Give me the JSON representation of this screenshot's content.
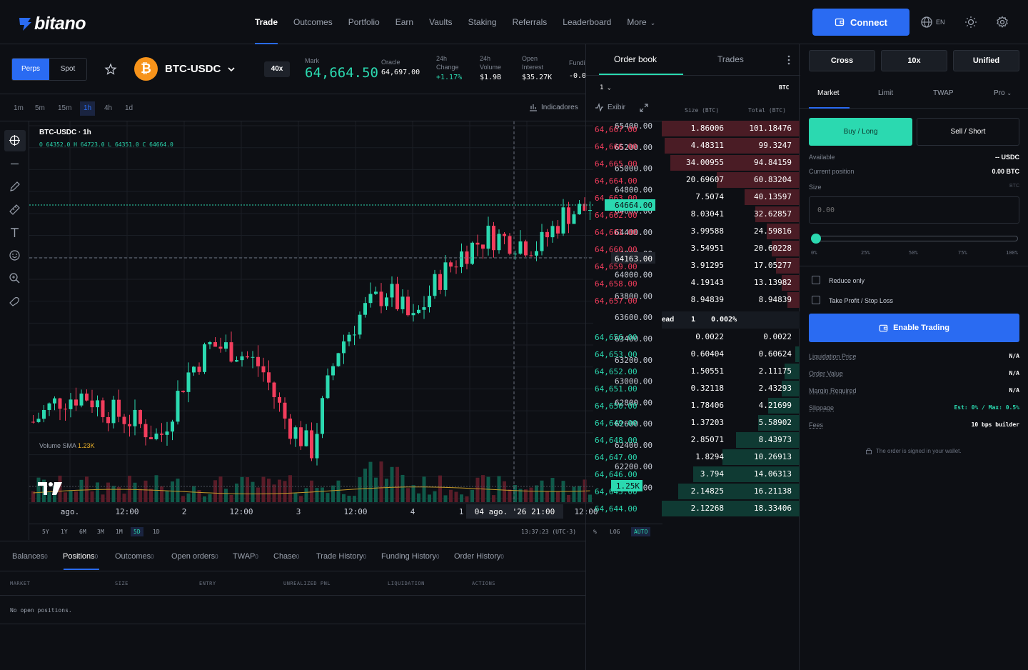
{
  "brand": {
    "name": "bitano"
  },
  "nav": {
    "links": [
      "Trade",
      "Outcomes",
      "Portfolio",
      "Earn",
      "Vaults",
      "Staking",
      "Referrals",
      "Leaderboard",
      "More"
    ],
    "active": "Trade",
    "connect_label": "Connect",
    "lang": "EN"
  },
  "market": {
    "toggle": [
      "Perps",
      "Spot"
    ],
    "pair": "BTC-USDC",
    "leverage_badge": "40x",
    "mark_label": "Mark",
    "mark_value": "64,664.50",
    "oracle_label": "Oracle",
    "oracle_value": "64,697.00",
    "change_label_1": "24h",
    "change_label_2": "Change",
    "change_value": "+1.17%",
    "volume_label_1": "24h",
    "volume_label_2": "Volume",
    "volume_value": "$1.9B",
    "oi_label_1": "Open",
    "oi_label_2": "Interest",
    "oi_value": "$35.27K",
    "funding_label": "Fundi",
    "funding_value": "-0.0"
  },
  "timeframes": [
    "1m",
    "5m",
    "15m",
    "1h",
    "4h",
    "1d"
  ],
  "active_timeframe": "1h",
  "chart_toolbar": {
    "indicators": "Indicadores",
    "view": "Exibir"
  },
  "chart_legend": {
    "title": "BTC-USDC · 1h",
    "ohlc": "O 64352.0 H 64723.0 L 64351.0 C 64664.0",
    "volume_sma_label": "Volume SMA",
    "volume_sma_value": "1.23K"
  },
  "chart_data": {
    "type": "candlestick",
    "price_axis_ticks": [
      "65400.00",
      "65200.00",
      "65000.00",
      "64800.00",
      "64600.00",
      "64400.00",
      "64200.00",
      "64000.00",
      "63800.00",
      "63600.00",
      "63400.00",
      "63200.00",
      "63000.00",
      "62800.00",
      "62600.00",
      "62400.00",
      "62200.00",
      "62000.00"
    ],
    "price_ylim": [
      62000,
      65400
    ],
    "last_price_label": "64664.00",
    "crosshair_price_label": "64163.00",
    "volume_label": "1.25K",
    "time_axis_labels": [
      "ago.",
      "12:00",
      "2",
      "12:00",
      "3",
      "12:00",
      "4",
      "1",
      "12:00"
    ],
    "crosshair_time_label": "04 ago. '26   21:00"
  },
  "range_bar": {
    "ranges": [
      "5Y",
      "1Y",
      "6M",
      "3M",
      "1M",
      "5D",
      "1D"
    ],
    "active": "5D",
    "clock": "13:37:23 (UTC-3)",
    "percent": "%",
    "log": "LOG",
    "auto": "AUTO"
  },
  "bottom": {
    "tabs": [
      {
        "label": "Balances",
        "count": "0"
      },
      {
        "label": "Positions",
        "count": "0"
      },
      {
        "label": "Outcomes",
        "count": "0"
      },
      {
        "label": "Open orders",
        "count": "0"
      },
      {
        "label": "TWAP",
        "count": "0"
      },
      {
        "label": "Chase",
        "count": "0"
      },
      {
        "label": "Trade History",
        "count": "0"
      },
      {
        "label": "Funding History",
        "count": "0"
      },
      {
        "label": "Order History",
        "count": "0"
      }
    ],
    "active_tab": "Positions",
    "columns": [
      "MARKET",
      "SIZE",
      "ENTRY",
      "UNREALIZED PNL",
      "LIQUIDATION",
      "ACTIONS"
    ],
    "empty_text": "No open positions."
  },
  "orderbook": {
    "tabs": [
      "Order book",
      "Trades"
    ],
    "grouping": "1",
    "unit": "BTC",
    "size_header": "Size (BTC)",
    "total_header": "Total (BTC)",
    "asks": [
      {
        "price": "64,667.00",
        "size": "1.86006",
        "total": "101.18476",
        "depth": 1.0
      },
      {
        "price": "64,666.00",
        "size": "4.48311",
        "total": "99.3247",
        "depth": 0.98
      },
      {
        "price": "64,665.00",
        "size": "34.00955",
        "total": "94.84159",
        "depth": 0.94
      },
      {
        "price": "64,664.00",
        "size": "20.69607",
        "total": "60.83204",
        "depth": 0.6
      },
      {
        "price": "64,663.00",
        "size": "7.5074",
        "total": "40.13597",
        "depth": 0.4
      },
      {
        "price": "64,662.00",
        "size": "8.03041",
        "total": "32.62857",
        "depth": 0.32
      },
      {
        "price": "64,661.00",
        "size": "3.99588",
        "total": "24.59816",
        "depth": 0.24
      },
      {
        "price": "64,660.00",
        "size": "3.54951",
        "total": "20.60228",
        "depth": 0.2
      },
      {
        "price": "64,659.00",
        "size": "3.91295",
        "total": "17.05277",
        "depth": 0.17
      },
      {
        "price": "64,658.00",
        "size": "4.19143",
        "total": "13.13982",
        "depth": 0.13
      },
      {
        "price": "64,657.00",
        "size": "8.94839",
        "total": "8.94839",
        "depth": 0.09
      }
    ],
    "spread_label": "ead",
    "spread_value": "1",
    "spread_pct": "0.002%",
    "bids": [
      {
        "price": "64,656.00",
        "size": "0.0022",
        "total": "0.0022",
        "depth": 0.0
      },
      {
        "price": "64,653.00",
        "size": "0.60404",
        "total": "0.60624",
        "depth": 0.03
      },
      {
        "price": "64,652.00",
        "size": "1.50551",
        "total": "2.11175",
        "depth": 0.11
      },
      {
        "price": "64,651.00",
        "size": "0.32118",
        "total": "2.43293",
        "depth": 0.13
      },
      {
        "price": "64,650.00",
        "size": "1.78406",
        "total": "4.21699",
        "depth": 0.23
      },
      {
        "price": "64,649.00",
        "size": "1.37203",
        "total": "5.58902",
        "depth": 0.3
      },
      {
        "price": "64,648.00",
        "size": "2.85071",
        "total": "8.43973",
        "depth": 0.46
      },
      {
        "price": "64,647.00",
        "size": "1.8294",
        "total": "10.26913",
        "depth": 0.56
      },
      {
        "price": "64,646.00",
        "size": "3.794",
        "total": "14.06313",
        "depth": 0.77
      },
      {
        "price": "64,645.00",
        "size": "2.14825",
        "total": "16.21138",
        "depth": 0.88
      },
      {
        "price": "64,644.00",
        "size": "2.12268",
        "total": "18.33406",
        "depth": 1.0
      }
    ]
  },
  "trade": {
    "margin_modes": [
      "Cross",
      "10x",
      "Unified"
    ],
    "order_tabs": [
      "Market",
      "Limit",
      "TWAP",
      "Pro"
    ],
    "active_order_tab": "Market",
    "buy_label": "Buy / Long",
    "sell_label": "Sell / Short",
    "available_label": "Available",
    "available_value": "-- USDC",
    "position_label": "Current position",
    "position_value": "0.00 BTC",
    "size_label": "Size",
    "size_unit": "BTC",
    "size_placeholder": "0.00",
    "size_percent": 0,
    "slider_ticks": [
      "0%",
      "25%",
      "50%",
      "75%",
      "100%"
    ],
    "reduce_only": "Reduce only",
    "tpsl": "Take Profit / Stop Loss",
    "enable_label": "Enable Trading",
    "info": [
      {
        "label": "Liquidation Price",
        "value": "N/A",
        "color": "#ffffff"
      },
      {
        "label": "Order Value",
        "value": "N/A",
        "color": "#ffffff"
      },
      {
        "label": "Margin Required",
        "value": "N/A",
        "color": "#ffffff"
      },
      {
        "label": "Slippage",
        "value": "Est: 0% / Max: 0.5%",
        "color": "#2bd9b0"
      },
      {
        "label": "Fees",
        "value": "10 bps builder",
        "color": "#ffffff"
      }
    ],
    "signed_note": "The order is signed in your wallet."
  },
  "colors": {
    "accent": "#2a6bf2",
    "up": "#2bd9b0",
    "down": "#f23d5c",
    "bg": "#0d0f14"
  }
}
